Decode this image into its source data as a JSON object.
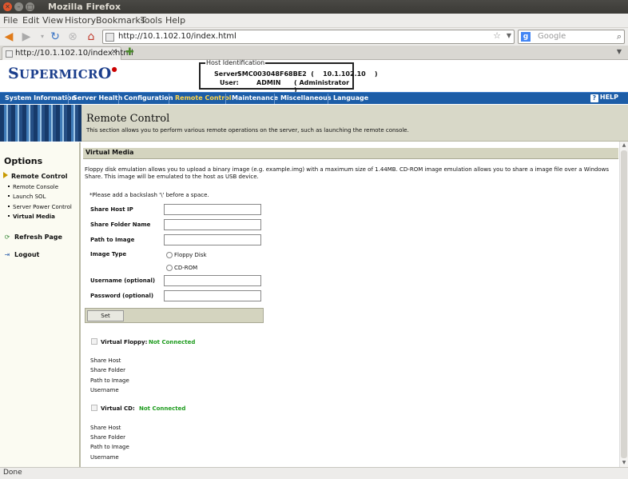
{
  "window": {
    "title": "Mozilla Firefox"
  },
  "menubar": {
    "items": [
      "File",
      "Edit",
      "View",
      "History",
      "Bookmarks",
      "Tools",
      "Help"
    ]
  },
  "navbar": {
    "url": "http://10.1.102.10/index.html",
    "search_placeholder": "Google"
  },
  "tabs": [
    {
      "label": "http://10.1.102.10/index.html"
    }
  ],
  "page": {
    "logo": {
      "main": "S",
      "rest": "UPERMICR",
      "tail": "O"
    },
    "host": {
      "legend": "Host Identification",
      "server_label": "Server:",
      "server_value": "SMC003048F68BE2  (    10.1.102.10    )",
      "user_label": "User:",
      "user_value": "ADMIN",
      "user_role": "( Administrator )"
    },
    "nav": {
      "items": [
        "System Information",
        "Server Health",
        "Configuration",
        "Remote Control",
        "Maintenance",
        "Miscellaneous",
        "Language"
      ],
      "selected": "Remote Control",
      "help": "HELP"
    },
    "header": {
      "title": "Remote Control",
      "subtitle": "This section allows you to perform various remote operations on the server, such as launching the remote console."
    },
    "options": {
      "title": "Options",
      "main": "Remote Control",
      "subitems": [
        "Remote Console",
        "Launch SOL",
        "Server Power Control",
        "Virtual Media"
      ],
      "refresh": "Refresh Page",
      "logout": "Logout"
    },
    "virtual_media": {
      "title": "Virtual Media",
      "description": "Floppy disk emulation allows you to upload a binary image (e.g. example.img) with a maximum size of 1.44MB. CD-ROM image emulation allows you to share a image file over a Windows Share. This image will be emulated to the host as USB device.",
      "note": "*Please add a backslash '\\' before a space.",
      "fields": {
        "share_host_ip": "Share Host IP",
        "share_folder_name": "Share Folder Name",
        "path_to_image": "Path to Image",
        "image_type": "Image Type",
        "username": "Username (optional)",
        "password": "Password (optional)"
      },
      "image_types": [
        "Floppy Disk",
        "CD-ROM"
      ],
      "set_button": "Set",
      "floppy": {
        "label": "Virtual Floppy:",
        "status": "Not Connected"
      },
      "cd": {
        "label": "Virtual CD:",
        "status": "Not Connected"
      },
      "detail_rows": [
        "Share Host",
        "Share Folder",
        "Path to Image",
        "Username"
      ]
    }
  },
  "status": {
    "text": "Done"
  },
  "colors": {
    "nav_blue": "#1c5da7",
    "selected_nav": "#ffd54a",
    "status_green": "#1d9b1d",
    "header_band": "#d8d8c8"
  }
}
